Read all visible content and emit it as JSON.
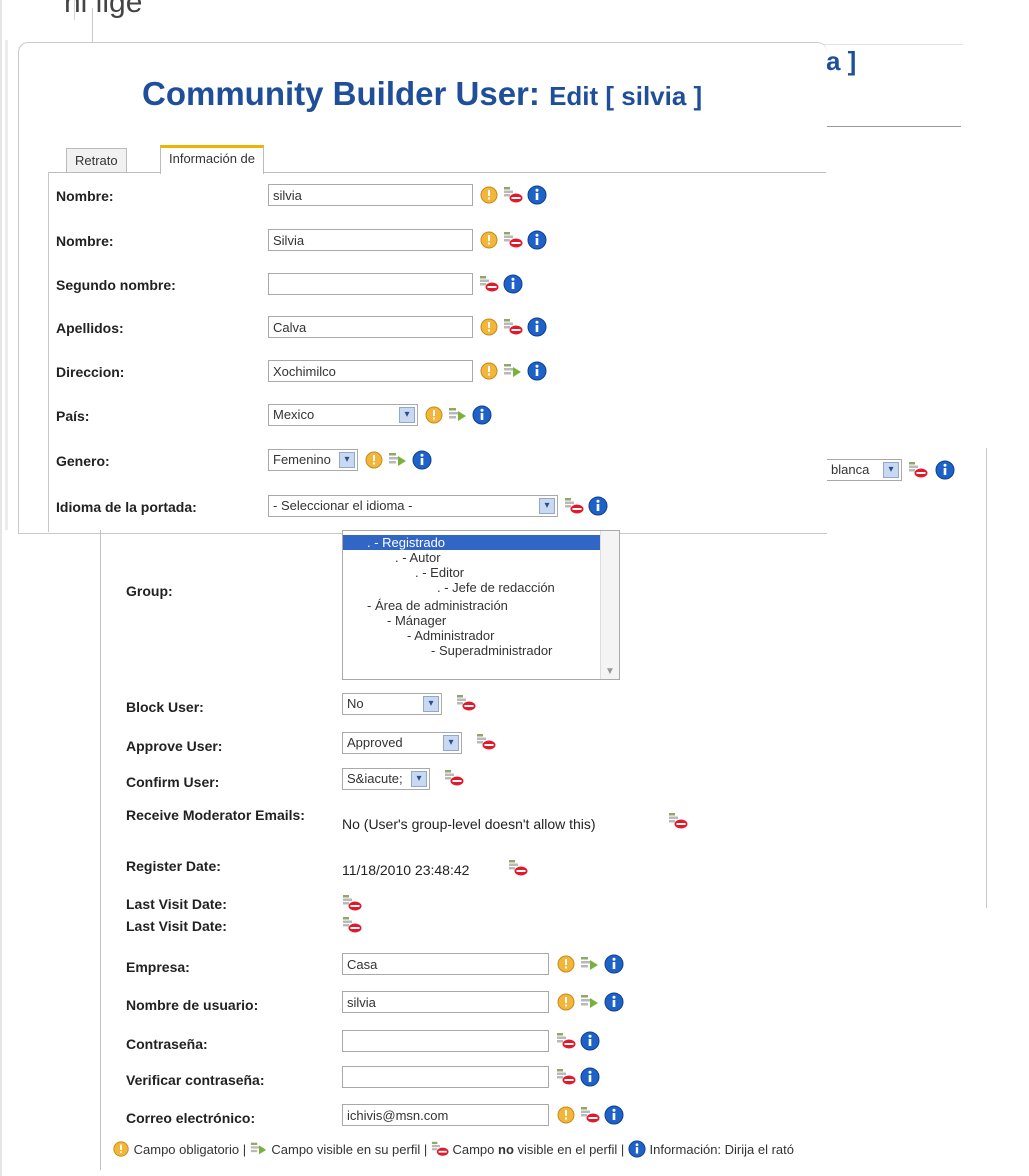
{
  "title": {
    "main": "Community Builder User:",
    "action": "Edit [ silvia ]",
    "fragment_bracket": "a ]",
    "fragment_top": "ni lige"
  },
  "tabs": [
    {
      "label": "Retrato",
      "active": false
    },
    {
      "label": "Información de",
      "active": true
    }
  ],
  "profile_fields": [
    {
      "label": "Nombre:",
      "value": "silvia",
      "type": "text",
      "icons": [
        "required-icon",
        "hidden-icon",
        "info-icon"
      ]
    },
    {
      "label": "Nombre:",
      "value": "Silvia",
      "type": "text",
      "icons": [
        "required-icon",
        "hidden-icon",
        "info-icon"
      ]
    },
    {
      "label": "Segundo nombre:",
      "value": "",
      "type": "text",
      "icons": [
        "hidden-icon",
        "info-icon"
      ]
    },
    {
      "label": "Apellidos:",
      "value": "Calva",
      "type": "text",
      "icons": [
        "required-icon",
        "hidden-icon",
        "info-icon"
      ]
    },
    {
      "label": "Direccion:",
      "value": "Xochimilco",
      "type": "text",
      "icons": [
        "required-icon",
        "visible-icon",
        "info-icon"
      ]
    },
    {
      "label": "País:",
      "value": "Mexico",
      "type": "select",
      "icons": [
        "required-icon",
        "visible-icon",
        "info-icon"
      ]
    },
    {
      "label": "Genero:",
      "value": "Femenino",
      "type": "select",
      "icons": [
        "required-icon",
        "visible-icon",
        "info-icon"
      ]
    },
    {
      "label": "Idioma de la portada:",
      "value": "- Seleccionar el idioma -",
      "type": "select",
      "icons": [
        "hidden-icon",
        "info-icon"
      ]
    }
  ],
  "fragment_select": "blanca",
  "group": {
    "label": "Group:",
    "options": [
      {
        "text": ". - Registrado",
        "selected": true,
        "indent": 0
      },
      {
        "text": ". - Autor",
        "selected": false,
        "indent": 1
      },
      {
        "text": ". - Editor",
        "selected": false,
        "indent": 2
      },
      {
        "text": ". - Jefe de redacción",
        "selected": false,
        "indent": 3
      },
      {
        "text": "- Área de administración",
        "selected": false,
        "indent": 0
      },
      {
        "text": "- Mánager",
        "selected": false,
        "indent": 1
      },
      {
        "text": "- Administrador",
        "selected": false,
        "indent": 2
      },
      {
        "text": "- Superadministrador",
        "selected": false,
        "indent": 3
      }
    ]
  },
  "user_settings": [
    {
      "label": "Block User:",
      "value": "No"
    },
    {
      "label": "Approve User:",
      "value": "Approved"
    },
    {
      "label": "Confirm User:",
      "value": "S&iacute;"
    }
  ],
  "moderator": {
    "label": "Receive Moderator Emails:",
    "value": "No (User's group-level doesn't allow this)"
  },
  "register_date": {
    "label": "Register Date:",
    "value": "11/18/2010 23:48:42"
  },
  "last_visit": [
    {
      "label": "Last Visit Date:"
    },
    {
      "label": "Last Visit Date:"
    }
  ],
  "account_fields": [
    {
      "label": "Empresa:",
      "value": "Casa",
      "icons": [
        "required-icon",
        "visible-icon",
        "info-icon"
      ]
    },
    {
      "label": "Nombre de usuario:",
      "value": "silvia",
      "icons": [
        "required-icon",
        "visible-icon",
        "info-icon"
      ]
    },
    {
      "label": "Contraseña:",
      "value": "",
      "icons": [
        "hidden-icon",
        "info-icon"
      ]
    },
    {
      "label": "Verificar contraseña:",
      "value": "",
      "icons": [
        "hidden-icon",
        "info-icon"
      ]
    },
    {
      "label": "Correo electrónico:",
      "value": "ichivis@msn.com",
      "icons": [
        "required-icon",
        "hidden-icon",
        "info-icon"
      ]
    }
  ],
  "legend": {
    "required": "Campo obligatorio |",
    "visible": "Campo visible en su perfil |",
    "hidden_pre": "Campo",
    "hidden_bold": "no",
    "hidden_post": "visible en el perfil |",
    "info": "Información: Dirija el rató"
  },
  "colors": {
    "title": "#1f4f9a",
    "tab_accent": "#f0b400",
    "selected_option": "#3165c6",
    "required_icon": "#f2b63a",
    "info_icon": "#1e62c8",
    "hidden_icon": "#e0192b"
  }
}
